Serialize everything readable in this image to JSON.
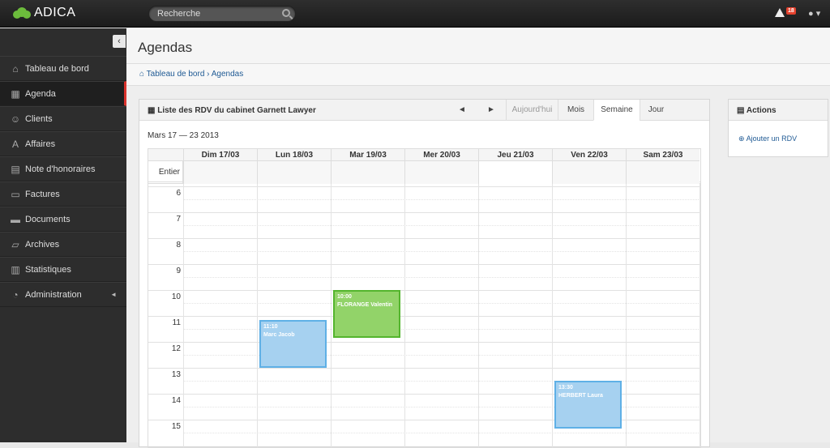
{
  "app": {
    "name": "ADICA",
    "search_placeholder": "Recherche",
    "alert_count": "18"
  },
  "sidebar": {
    "items": [
      {
        "label": "Tableau de bord",
        "icon": "home-icon",
        "glyph": "⌂"
      },
      {
        "label": "Agenda",
        "icon": "calendar-icon",
        "glyph": "▦"
      },
      {
        "label": "Clients",
        "icon": "users-icon",
        "glyph": "☺"
      },
      {
        "label": "Affaires",
        "icon": "font-icon",
        "glyph": "A"
      },
      {
        "label": "Note d'honoraires",
        "icon": "file-icon",
        "glyph": "▤"
      },
      {
        "label": "Factures",
        "icon": "money-icon",
        "glyph": "▭"
      },
      {
        "label": "Documents",
        "icon": "inbox-icon",
        "glyph": "▬"
      },
      {
        "label": "Archives",
        "icon": "folder-icon",
        "glyph": "▱"
      },
      {
        "label": "Statistiques",
        "icon": "chart-icon",
        "glyph": "▥"
      },
      {
        "label": "Administration",
        "icon": "dashboard-icon",
        "glyph": "◔"
      }
    ]
  },
  "page": {
    "title": "Agendas"
  },
  "breadcrumb": {
    "home": "Tableau de bord",
    "separator": "›",
    "current": "Agendas"
  },
  "calendar": {
    "title": "Liste des RDV du cabinet Garnett Lawyer",
    "prev": "◄",
    "next": "►",
    "today": "Aujourd'hui",
    "views": [
      "Mois",
      "Semaine",
      "Jour"
    ],
    "active_view": "Semaine",
    "range": "Mars 17 — 23 2013",
    "days": [
      "Dim 17/03",
      "Lun 18/03",
      "Mar 19/03",
      "Mer 20/03",
      "Jeu 21/03",
      "Ven 22/03",
      "Sam 23/03"
    ],
    "allday_label": "Entier",
    "hours": [
      "6",
      "7",
      "8",
      "9",
      "10",
      "11",
      "12",
      "13",
      "14",
      "15"
    ],
    "events": [
      {
        "time": "11:10",
        "title": "Marc Jacob",
        "day": 1,
        "start": 11.17,
        "end": 13.0,
        "color": "blue"
      },
      {
        "time": "10:00",
        "title": "FLORANGE Valentin",
        "day": 2,
        "start": 10.0,
        "end": 11.83,
        "color": "green"
      },
      {
        "time": "13:30",
        "title": "HERBERT Laura",
        "day": 5,
        "start": 13.5,
        "end": 15.33,
        "color": "blue"
      }
    ]
  },
  "actions": {
    "title": "Actions",
    "add_label": "Ajouter un RDV"
  }
}
